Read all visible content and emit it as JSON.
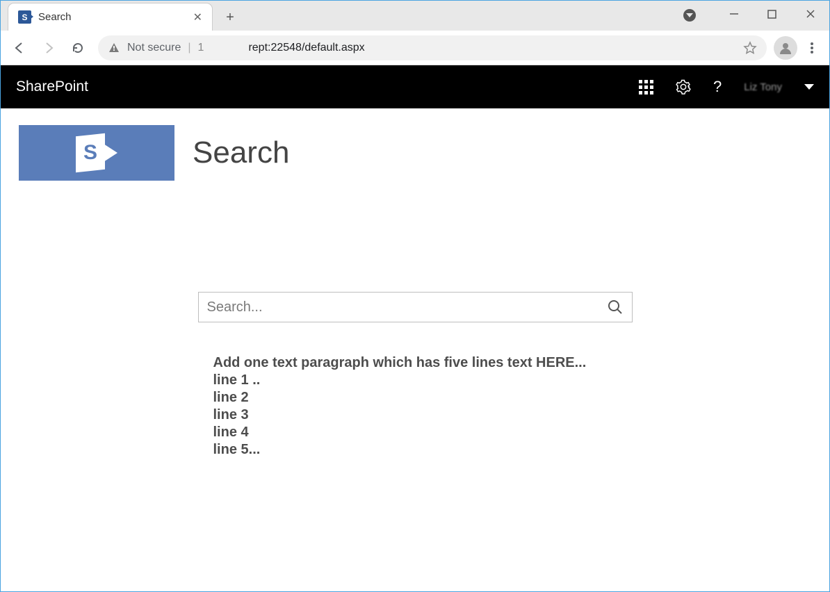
{
  "browser": {
    "tab": {
      "title": "Search",
      "favicon_letter": "S"
    },
    "security_label": "Not secure",
    "url_prefix": "1",
    "url_display": "rept:22548/default.aspx"
  },
  "sp_header": {
    "brand": "SharePoint",
    "help_label": "?",
    "user_hint": "Liz  Tony"
  },
  "page": {
    "title": "Search",
    "logo_letter": "S"
  },
  "search": {
    "placeholder": "Search...",
    "value": ""
  },
  "paragraph": {
    "heading": "Add one text paragraph which has five lines text HERE...",
    "lines": [
      "line 1 ..",
      "line 2",
      "line 3",
      "line 4",
      "line 5..."
    ]
  }
}
